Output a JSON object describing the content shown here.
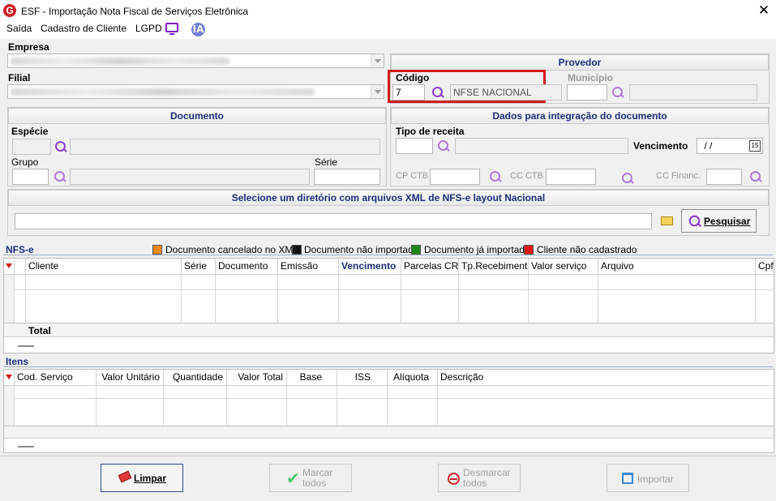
{
  "window": {
    "title": "ESF - Importação Nota Fiscal de Serviços Eletrônica",
    "logo": "G",
    "close": "✕"
  },
  "menu": {
    "items": [
      "Saída",
      "Cadastro de Cliente",
      "LGPD"
    ],
    "ia": "IA"
  },
  "empresa": {
    "label": "Empresa"
  },
  "filial": {
    "label": "Filial"
  },
  "provedor": {
    "title": "Provedor",
    "codigo_label": "Código",
    "codigo_value": "7",
    "provedor_name": "NFSE NACIONAL",
    "municipio_label": "Município"
  },
  "documento": {
    "title": "Documento",
    "especie_label": "Espécie",
    "grupo_label": "Grupo",
    "serie_label": "Série"
  },
  "integracao": {
    "title": "Dados para integração do documento",
    "tipo_receita_label": "Tipo de receita",
    "vencimento_label": "Vencimento",
    "vencimento_value": " / /",
    "cal": "15",
    "cp_ctb_label": "CP CTB",
    "cc_ctb_label": "CC CTB",
    "cc_financ_label": "CC Financ."
  },
  "diretorio": {
    "title": "Selecione um diretório com arquivos XML de NFS-e layout Nacional",
    "search_button": "Pesquisar"
  },
  "nfse": {
    "title": "NFS-e",
    "legend": [
      {
        "label": "Documento cancelado no XML",
        "color": "#f08a1c"
      },
      {
        "label": "Documento não importado",
        "color": "#111111"
      },
      {
        "label": "Documento já importado",
        "color": "#1a8a1a"
      },
      {
        "label": "Cliente não cadastrado",
        "color": "#e01818"
      }
    ],
    "columns": [
      "Cliente",
      "Série",
      "Documento",
      "Emissão",
      "Vencimento",
      "Parcelas CRC",
      "Tp.Recebimento",
      "Valor serviço",
      "Arquivo",
      "Cpf."
    ],
    "total_label": "Total"
  },
  "itens": {
    "title": "Itens",
    "columns": [
      "Cod. Serviço",
      "Valor Unitário",
      "Quantidade",
      "Valor Total",
      "Base",
      "ISS",
      "Alíquota",
      "Descrição"
    ]
  },
  "buttons": {
    "limpar": "Limpar",
    "marcar": "Marcar todos",
    "desmarcar": "Desmarcar todos",
    "importar": "Importar"
  },
  "colors": {
    "accent_title": "#1a2e7a",
    "icon_purple": "#8d3fcf",
    "highlight_red": "#d11b1b"
  }
}
